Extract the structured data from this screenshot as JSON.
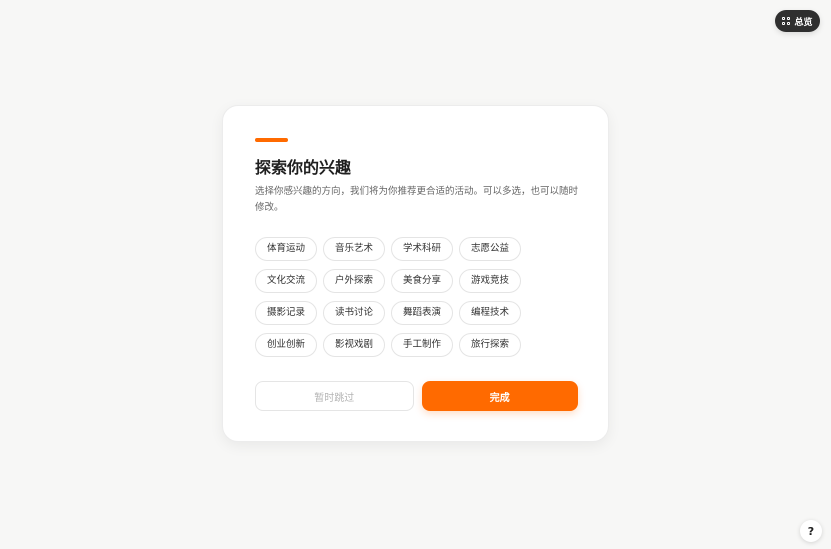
{
  "overview": {
    "label": "总览",
    "icon": "grid-icon"
  },
  "card": {
    "title": "探索你的兴趣",
    "subtitle": "选择你感兴趣的方向，我们将为你推荐更合适的活动。可以多选，也可以随时修改。",
    "interests": [
      "体育运动",
      "音乐艺术",
      "学术科研",
      "志愿公益",
      "文化交流",
      "户外探索",
      "美食分享",
      "游戏竞技",
      "摄影记录",
      "读书讨论",
      "舞蹈表演",
      "编程技术",
      "创业创新",
      "影视戏剧",
      "手工制作",
      "旅行探索"
    ],
    "skip_label": "暂时跳过",
    "done_label": "完成"
  },
  "help": {
    "label": "?",
    "icon": "help-icon"
  },
  "colors": {
    "accent": "#ff6a00",
    "background": "#f7f7f6",
    "card": "#ffffff",
    "dark_button": "#2f2f2f"
  }
}
